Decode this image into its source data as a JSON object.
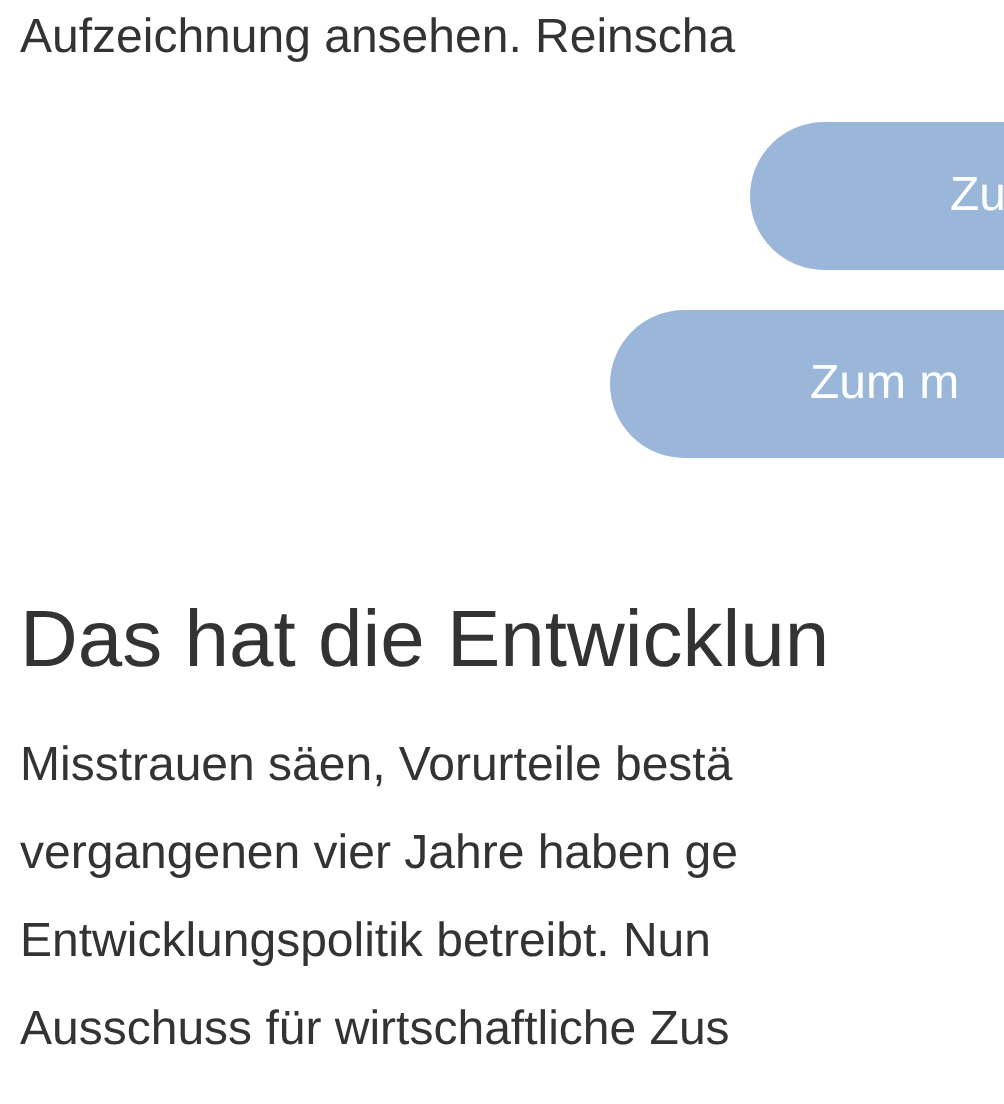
{
  "intro_text": "Aufzeichnung ansehen. Reinscha",
  "buttons": [
    {
      "label": "Zu"
    },
    {
      "label": "Zum m"
    }
  ],
  "heading": "Das hat die Entwicklun",
  "paragraph_lines": [
    "Misstrauen säen, Vorurteile bestä",
    "vergangenen vier Jahre haben ge",
    "Entwicklungspolitik betreibt. Nun",
    "Ausschuss für wirtschaftliche Zus"
  ]
}
